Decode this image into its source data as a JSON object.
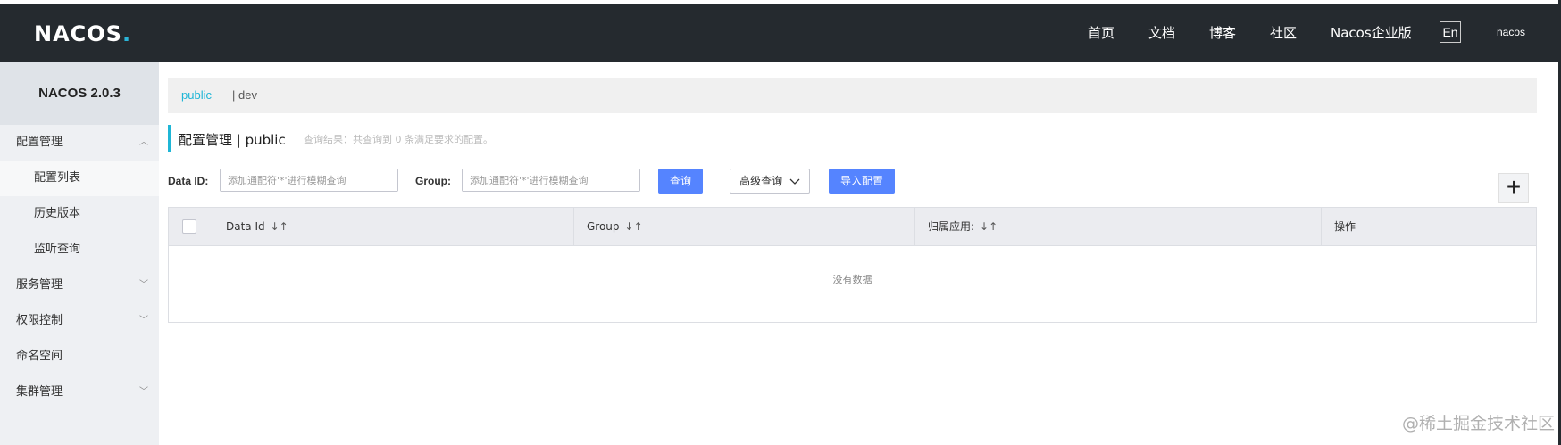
{
  "header": {
    "logo_text": "NACOS",
    "logo_dot": ".",
    "nav": [
      "首页",
      "文档",
      "博客",
      "社区",
      "Nacos企业版"
    ],
    "lang": "En",
    "user": "nacos"
  },
  "sidebar": {
    "version": "NACOS 2.0.3",
    "items": [
      {
        "label": "配置管理",
        "chevron": "︿"
      },
      {
        "label": "配置列表"
      },
      {
        "label": "历史版本"
      },
      {
        "label": "监听查询"
      },
      {
        "label": "服务管理",
        "chevron": "﹀"
      },
      {
        "label": "权限控制",
        "chevron": "﹀"
      },
      {
        "label": "命名空间"
      },
      {
        "label": "集群管理",
        "chevron": "﹀"
      }
    ]
  },
  "namespace": {
    "active": "public",
    "other": "| dev"
  },
  "title": {
    "text": "配置管理 | public",
    "hint": "查询结果：共查询到 0 条满足要求的配置。"
  },
  "filters": {
    "data_id_label": "Data ID:",
    "data_id_placeholder": "添加通配符'*'进行模糊查询",
    "group_label": "Group:",
    "group_placeholder": "添加通配符'*'进行模糊查询",
    "query_btn": "查询",
    "advanced_btn": "高级查询",
    "import_btn": "导入配置",
    "add_btn": "+"
  },
  "table": {
    "columns": [
      "Data Id",
      "Group",
      "归属应用:",
      "操作"
    ],
    "sort_glyph": "↓↑",
    "empty_text": "没有数据"
  },
  "watermark": "@稀土掘金技术社区"
}
